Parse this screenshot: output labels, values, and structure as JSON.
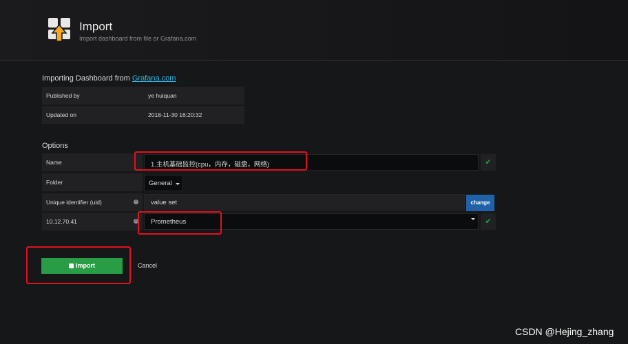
{
  "header": {
    "title": "Import",
    "subtitle": "Import dashboard from file or Grafana.com"
  },
  "importing": {
    "prefix": "Importing Dashboard from ",
    "link": "Grafana.com",
    "rows": [
      {
        "label": "Published by",
        "value": "ye huiquan"
      },
      {
        "label": "Updated on",
        "value": "2018-11-30 16:20:32"
      }
    ]
  },
  "options": {
    "title": "Options",
    "name_label": "Name",
    "name_value": "1.主机基础监控(cpu，内存，磁盘，网络)",
    "folder_label": "Folder",
    "folder_value": "General",
    "uid_label": "Unique identifier (uid)",
    "uid_value": "value set",
    "change_label": "change",
    "datasource_label": "10.12.70.41",
    "datasource_value": "Prometheus"
  },
  "actions": {
    "import_label": "Import",
    "cancel_label": "Cancel"
  },
  "watermark": "CSDN @Hejing_zhang",
  "colors": {
    "accent_green": "#299c46",
    "accent_blue": "#1f62a8",
    "highlight_red": "#e2121e",
    "link": "#33b5e5"
  }
}
